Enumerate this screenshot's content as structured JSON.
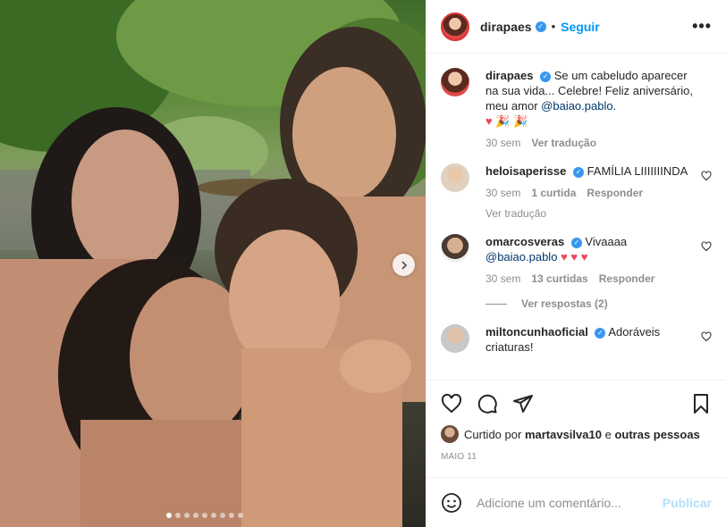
{
  "header": {
    "username": "dirapaes",
    "separator": "•",
    "follow_label": "Seguir",
    "more_label": "•••"
  },
  "photo": {
    "slide_count": 9,
    "active_slide": 1
  },
  "caption": {
    "username": "dirapaes",
    "text": "Se um cabeludo aparecer na sua vida... Celebre! Feliz aniversário, meu amor",
    "mention": "@baiao.pablo.",
    "emojis": "♥ 🎉 🎉",
    "time": "30 sem",
    "translate": "Ver tradução"
  },
  "comments": [
    {
      "username": "heloisaperisse",
      "text": "FAMÍLIA LIIIIIIINDA",
      "time": "30 sem",
      "likes": "1 curtida",
      "reply": "Responder",
      "translate": "Ver tradução"
    },
    {
      "username": "omarcosveras",
      "text": "Vivaaaa",
      "mention": "@baiao.pablo",
      "hearts": "♥ ♥ ♥",
      "time": "30 sem",
      "likes": "13 curtidas",
      "reply": "Responder",
      "view_replies": "Ver respostas (2)"
    },
    {
      "username": "miltoncunhaoficial",
      "text": "Adoráveis criaturas!"
    }
  ],
  "actions": {
    "liked_by_prefix": "Curtido por",
    "liked_by_user": "martavsilva10",
    "liked_by_suffix": "e",
    "liked_by_others": "outras pessoas",
    "date": "MAIO 11"
  },
  "composer": {
    "placeholder": "Adicione um comentário...",
    "publish_label": "Publicar"
  },
  "colors": {
    "link": "#0095f6",
    "verified": "#3897f0",
    "heart": "#ed4956",
    "muted": "#8e8e8e"
  }
}
